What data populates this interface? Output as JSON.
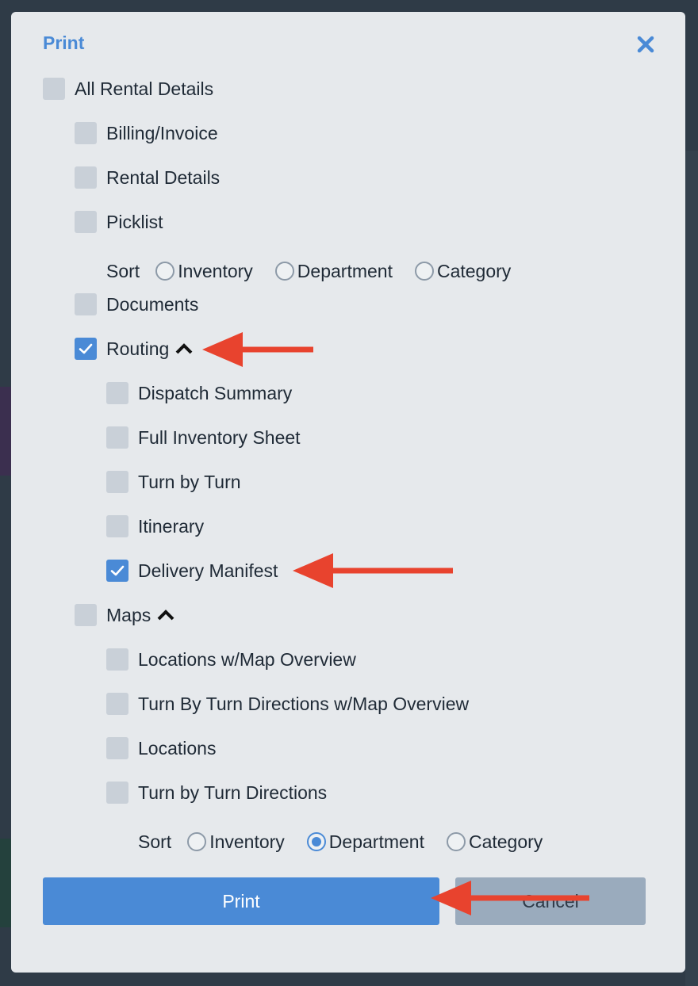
{
  "dialog": {
    "title": "Print",
    "close_icon": "close-icon"
  },
  "options": {
    "all_rental_details": {
      "label": "All Rental Details",
      "checked": false
    },
    "billing_invoice": {
      "label": "Billing/Invoice",
      "checked": false
    },
    "rental_details": {
      "label": "Rental Details",
      "checked": false
    },
    "picklist": {
      "label": "Picklist",
      "checked": false
    },
    "picklist_sort": {
      "label": "Sort",
      "options": [
        "Inventory",
        "Department",
        "Category"
      ],
      "selected": ""
    },
    "documents": {
      "label": "Documents",
      "checked": false
    },
    "routing": {
      "label": "Routing",
      "checked": true,
      "expanded": true
    },
    "dispatch_summary": {
      "label": "Dispatch Summary",
      "checked": false
    },
    "full_inventory_sheet": {
      "label": "Full Inventory Sheet",
      "checked": false
    },
    "turn_by_turn": {
      "label": "Turn by Turn",
      "checked": false
    },
    "itinerary": {
      "label": "Itinerary",
      "checked": false
    },
    "delivery_manifest": {
      "label": "Delivery Manifest",
      "checked": true
    },
    "maps": {
      "label": "Maps",
      "checked": false,
      "expanded": true
    },
    "locations_map_overview": {
      "label": "Locations w/Map Overview",
      "checked": false
    },
    "turn_by_turn_directions_map_overview": {
      "label": "Turn By Turn Directions w/Map Overview",
      "checked": false
    },
    "locations": {
      "label": "Locations",
      "checked": false
    },
    "turn_by_turn_directions": {
      "label": "Turn by Turn Directions",
      "checked": false
    },
    "maps_sort": {
      "label": "Sort",
      "options": [
        "Inventory",
        "Department",
        "Category"
      ],
      "selected": "Department"
    }
  },
  "buttons": {
    "print_label": "Print",
    "cancel_label": "Cancel"
  },
  "colors": {
    "accent": "#4a8ad6",
    "annotation_arrow": "#e8432e",
    "modal_bg": "#e6e9ec",
    "backdrop": "#2f3b47"
  }
}
